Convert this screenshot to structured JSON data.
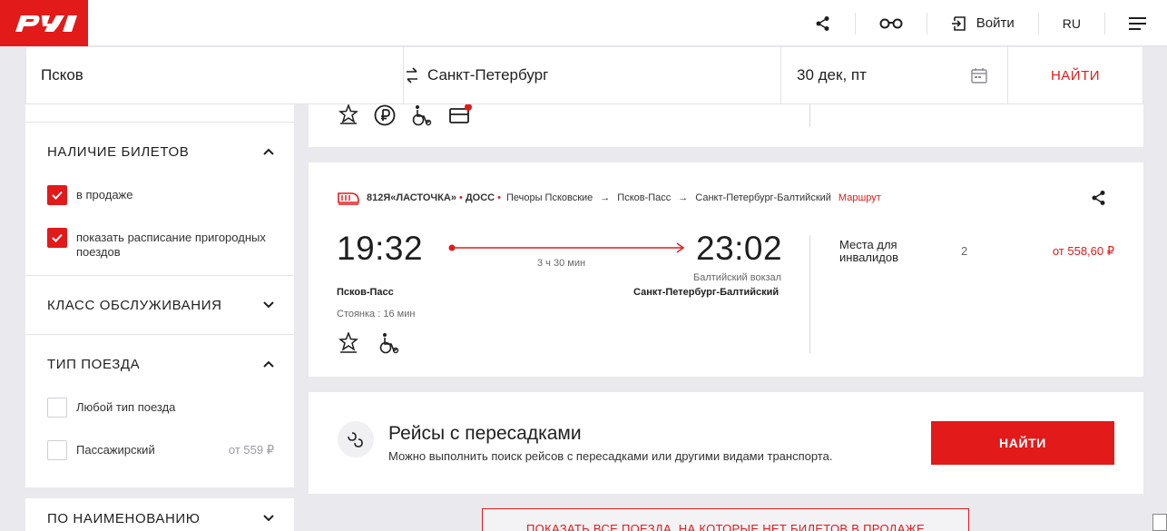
{
  "header": {
    "logo_text": "РЖД",
    "login_label": "Войти",
    "lang_label": "RU"
  },
  "search": {
    "from": "Псков",
    "to": "Санкт-Петербург",
    "date": "30 дек, пт",
    "find_label": "НАЙТИ"
  },
  "sidebar": {
    "availability": {
      "title": "НАЛИЧИЕ БИЛЕТОВ",
      "options": [
        {
          "label": "в продаже",
          "checked": true
        },
        {
          "label": "показать расписание пригородных поездов",
          "checked": true
        }
      ]
    },
    "service_class": {
      "title": "КЛАСС ОБСЛУЖИВАНИЯ"
    },
    "train_type": {
      "title": "ТИП ПОЕЗДА",
      "options": [
        {
          "label": "Любой тип поезда",
          "checked": false,
          "price": ""
        },
        {
          "label": "Пассажирский",
          "checked": false,
          "price": "от 559 ₽"
        }
      ]
    },
    "by_name": {
      "title": "ПО НАИМЕНОВАНИЮ"
    }
  },
  "train": {
    "number": "812Я«ЛАСТОЧКА»",
    "carrier": "ДОСС",
    "origin": "Печоры Псковские",
    "from_station": "Псков-Пасс",
    "to_station": "Санкт-Петербург-Балтийский",
    "route_link": "Маршрут",
    "depart_time": "19:32",
    "arrive_time": "23:02",
    "duration": "3 ч 30 мин",
    "arrive_terminal": "Балтийский вокзал",
    "depart_station_bold": "Псков-Пасс",
    "arrive_station_bold": "Санкт-Петербург-Балтийский",
    "stop": "Стоянка : 16 мин",
    "seat_type": "Места для инвалидов",
    "seat_count": "2",
    "price": "от 558,60 ₽"
  },
  "transfers": {
    "title": "Рейсы с пересадками",
    "subtitle": "Можно выполнить поиск рейсов с пересадками или другими видами транспорта.",
    "button": "НАЙТИ"
  },
  "show_all": "ПОКАЗАТЬ ВСЕ ПОЕЗДА, НА КОТОРЫЕ НЕТ БИЛЕТОВ В ПРОДАЖЕ",
  "colors": {
    "accent": "#e21a1a",
    "background": "#e9e9ee"
  }
}
